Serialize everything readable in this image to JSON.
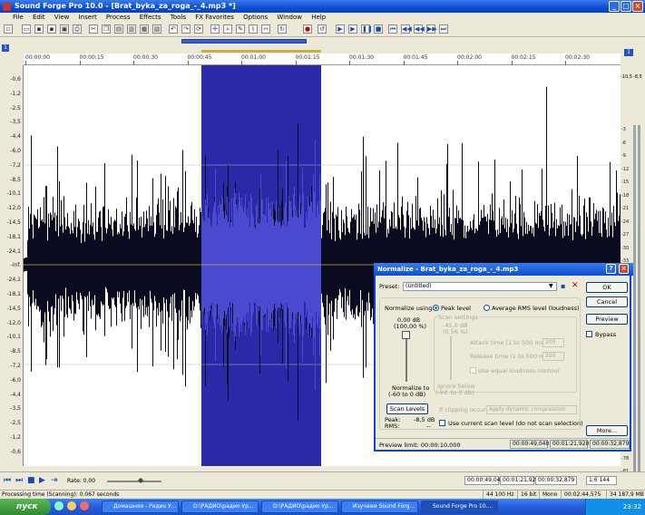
{
  "window": {
    "title": "Sound Forge Pro 10.0 - [Brat_byka_za_roga_-_4.mp3 *]"
  },
  "menu": [
    "File",
    "Edit",
    "View",
    "Insert",
    "Process",
    "Effects",
    "Tools",
    "FX Favorites",
    "Options",
    "Window",
    "Help"
  ],
  "ruler": [
    "00:00:00",
    "00:00:15",
    "00:00:30",
    "00:00:45",
    "00:01:00",
    "00:01:15",
    "00:01:30",
    "00:01:45",
    "00:02:00",
    "00:02:15",
    "00:02:30"
  ],
  "db_scale": [
    "-0,6",
    "-1,2",
    "-2,5",
    "-3,5",
    "-4,4",
    "-6,0",
    "-7,2",
    "-8,5",
    "-10,1",
    "-12,0",
    "-14,5",
    "-18,1",
    "-24,1",
    "-Inf.",
    "-24,1",
    "-18,1",
    "-14,5",
    "-12,0",
    "-10,1",
    "-8,5",
    "-7,2",
    "-6,0",
    "-4,4",
    "-3,5",
    "-2,5",
    "-1,2",
    "-0,6"
  ],
  "meter": {
    "top_left": "-10,5",
    "top_right": "-8,5",
    "scale": [
      "3",
      "6",
      "9",
      "12",
      "15",
      "18",
      "21",
      "24",
      "27",
      "30",
      "33",
      "36",
      "39",
      "42",
      "45",
      "48",
      "51",
      "54",
      "57",
      "60",
      "63",
      "66",
      "69",
      "72",
      "75",
      "78",
      "81",
      "84",
      "87"
    ]
  },
  "transport": {
    "rate_label": "Rate: 0,00",
    "pos1": "00:00:49,040",
    "pos2": "00:01:21,920",
    "pos3": "00:00:32,879",
    "zoom": "1:6 144"
  },
  "status": {
    "message": "Processing time (Scanning): 0.067 seconds",
    "rate": "44 100 Hz",
    "bits": "16 bit",
    "channels": "Mono",
    "length": "00:02:44,575",
    "free": "34 187,9 MB"
  },
  "dialog": {
    "title": "Normalize - Brat_byka_za_roga_-_4.mp3",
    "preset_label": "Preset:",
    "preset_value": "(Untitled)",
    "ok": "OK",
    "cancel": "Cancel",
    "preview": "Preview",
    "bypass": "Bypass",
    "more": "More...",
    "normalize_using": "Normalize using:",
    "peak_level": "Peak level",
    "rms_level": "Average RMS level (loudness)",
    "slider_top_db": "0,00 dB",
    "slider_top_pct": "(100,00 %)",
    "normalize_to": "Normalize to",
    "normalize_range": "(-60 to 0 dB)",
    "scan_settings": "Scan settings",
    "rms_db": "-45,0 dB",
    "rms_pct": "(0,56 %)",
    "attack_label": "Attack time (1 to 500 ms):",
    "attack_value": "200",
    "release_label": "Release time (1 to 500 ms):",
    "release_value": "200",
    "equal_contour": "Use equal loudness contour",
    "ignore_below": "Ignore below",
    "ignore_range": "(-Inf. to 0 dB)",
    "clipping_label": "If clipping occurs:",
    "clipping_value": "Apply dynamic compression",
    "scan_levels": "Scan Levels",
    "peak_label": "Peak:",
    "peak_value": "-8,5 dB",
    "rms_label": "RMS:",
    "rms_value": "--",
    "use_current": "Use current scan level (do not scan selection)",
    "preview_limit": "Preview limit: 00:00:10,000",
    "pos1": "00:00:49,040",
    "pos2": "00:01:21,920",
    "pos3": "00:00:32,879"
  },
  "taskbar": {
    "start": "пуск",
    "tasks": [
      "Домашняя - Радио У...",
      "D:\\РАДИО\\радио Ур...",
      "D:\\РАДИО\\радио Ур...",
      "Изучаем Sound Forg...",
      "Sound Forge Pro 10...."
    ],
    "clock": "23:32"
  },
  "colors": {
    "selection": "#2a2aa8",
    "waveform": "#0a0a20",
    "accent": "#0a4fd1"
  }
}
